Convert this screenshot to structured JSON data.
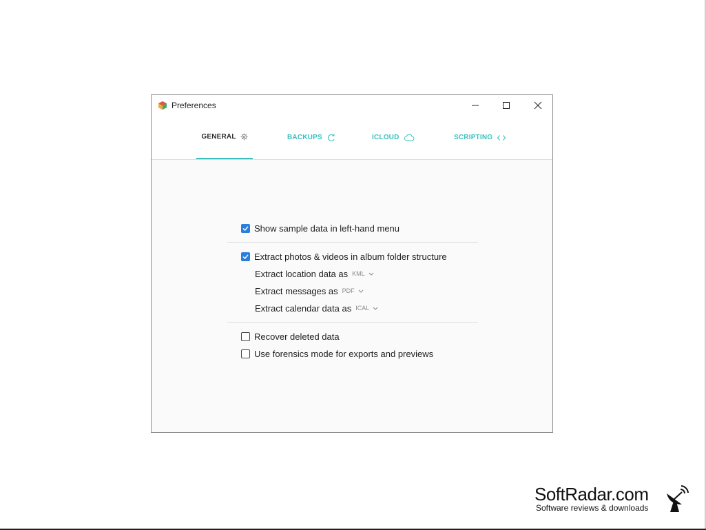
{
  "window": {
    "title": "Preferences"
  },
  "tabs": [
    {
      "label": "GENERAL",
      "icon": "gear-icon",
      "active": true
    },
    {
      "label": "BACKUPS",
      "icon": "refresh-icon",
      "active": false
    },
    {
      "label": "ICLOUD",
      "icon": "cloud-icon",
      "active": false
    },
    {
      "label": "SCRIPTING",
      "icon": "code-icon",
      "active": false
    }
  ],
  "settings": {
    "show_sample": {
      "label": "Show sample data in left-hand menu",
      "checked": true
    },
    "extract_photos": {
      "label": "Extract photos & videos in album folder structure",
      "checked": true
    },
    "location": {
      "label": "Extract location data as",
      "value": "KML"
    },
    "messages": {
      "label": "Extract messages as",
      "value": "PDF"
    },
    "calendar": {
      "label": "Extract calendar data as",
      "value": "ICAL"
    },
    "recover_deleted": {
      "label": "Recover deleted data",
      "checked": false
    },
    "forensics": {
      "label": "Use forensics mode for exports and previews",
      "checked": false
    }
  },
  "watermark": {
    "brand": "SoftRadar.com",
    "tagline": "Software reviews & downloads"
  },
  "colors": {
    "accent": "#3cc0bf",
    "checkbox": "#2a7fdd"
  }
}
